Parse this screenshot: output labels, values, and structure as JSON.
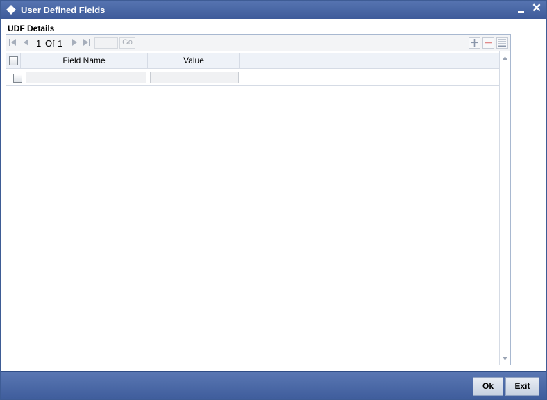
{
  "window": {
    "title": "User Defined Fields",
    "close_symbol": "✕"
  },
  "section": {
    "title": "UDF Details"
  },
  "pagination": {
    "current_page": "1",
    "of_label": "Of",
    "total_pages": "1",
    "go_label": "Go"
  },
  "grid": {
    "columns": [
      "Field Name",
      "Value"
    ],
    "rows": [
      {
        "field_name": "",
        "value": ""
      }
    ]
  },
  "footer": {
    "ok_label": "Ok",
    "exit_label": "Exit"
  },
  "colors": {
    "title_bar": "#4a68a6",
    "footer_bar": "#4a68a6",
    "header_row": "#eef2f8"
  }
}
